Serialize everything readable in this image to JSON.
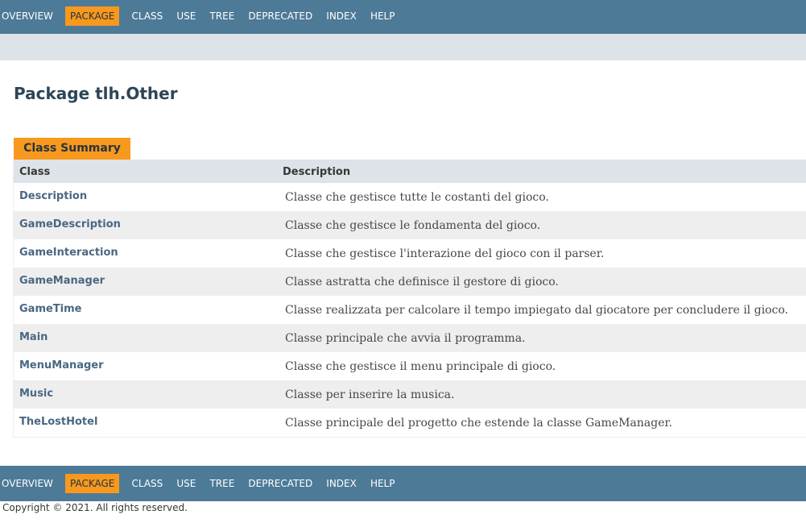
{
  "nav": {
    "items": [
      {
        "label": "OVERVIEW",
        "active": false
      },
      {
        "label": "PACKAGE",
        "active": true
      },
      {
        "label": "CLASS",
        "active": false
      },
      {
        "label": "USE",
        "active": false
      },
      {
        "label": "TREE",
        "active": false
      },
      {
        "label": "DEPRECATED",
        "active": false
      },
      {
        "label": "INDEX",
        "active": false
      },
      {
        "label": "HELP",
        "active": false
      }
    ]
  },
  "page": {
    "title": "Package tlh.Other"
  },
  "summary": {
    "caption": "Class Summary",
    "columns": [
      "Class",
      "Description"
    ],
    "rows": [
      {
        "name": "Description",
        "description": "Classe che gestisce tutte le costanti del gioco."
      },
      {
        "name": "GameDescription",
        "description": "Classe che gestisce le fondamenta del gioco."
      },
      {
        "name": "GameInteraction",
        "description": "Classe che gestisce l'interazione del gioco con il parser."
      },
      {
        "name": "GameManager",
        "description": "Classe astratta che definisce il gestore di gioco."
      },
      {
        "name": "GameTime",
        "description": "Classe realizzata per calcolare il tempo impiegato dal giocatore per concludere il gioco."
      },
      {
        "name": "Main",
        "description": "Classe principale che avvia il programma."
      },
      {
        "name": "MenuManager",
        "description": "Classe che gestisce il menu principale di gioco."
      },
      {
        "name": "Music",
        "description": "Classe per inserire la musica."
      },
      {
        "name": "TheLostHotel",
        "description": "Classe principale del progetto che estende la classe GameManager."
      }
    ]
  },
  "footer": {
    "copyright": "Copyright © 2021. All rights reserved."
  },
  "colors": {
    "nav_bg": "#4d7a97",
    "nav_active": "#f8981d",
    "subnav_bg": "#dee3e9",
    "link": "#4a6782",
    "row_alt": "#eeeeef"
  }
}
